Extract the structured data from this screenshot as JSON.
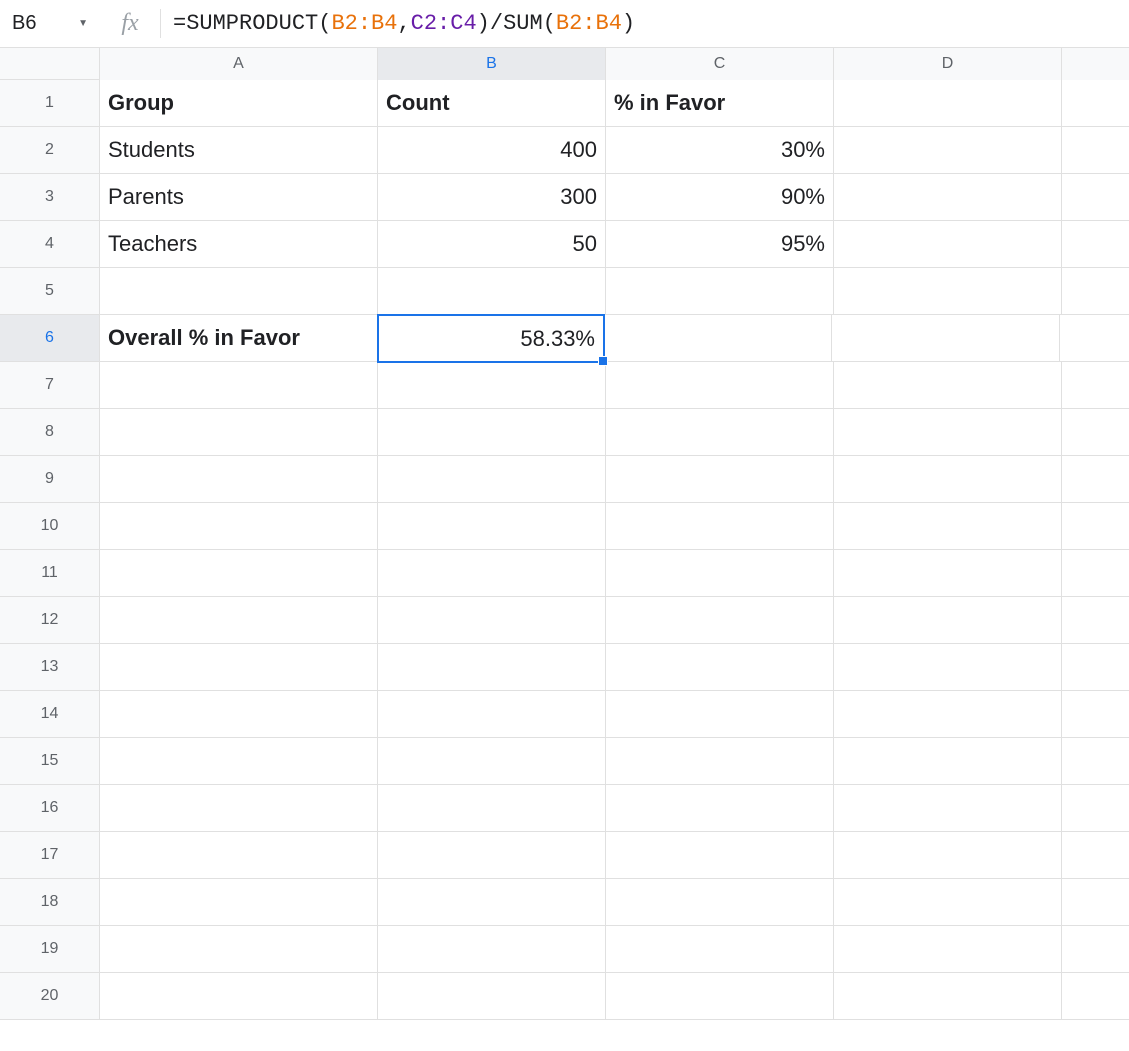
{
  "nameBox": "B6",
  "formula": {
    "prefix": "=SUMPRODUCT",
    "paren1": "(",
    "range1": "B2:B4",
    "comma": ", ",
    "range2": "C2:C4",
    "paren2": ")",
    "div": "/SUM",
    "paren3": "(",
    "range3": "B2:B4",
    "paren4": ")"
  },
  "columns": [
    "A",
    "B",
    "C",
    "D"
  ],
  "activeCol": "B",
  "activeRow": "6",
  "rows": [
    "1",
    "2",
    "3",
    "4",
    "5",
    "6",
    "7",
    "8",
    "9",
    "10",
    "11",
    "12",
    "13",
    "14",
    "15",
    "16",
    "17",
    "18",
    "19",
    "20"
  ],
  "cells": {
    "A1": "Group",
    "B1": "Count",
    "C1": "% in Favor",
    "A2": "Students",
    "B2": "400",
    "C2": "30%",
    "A3": "Parents",
    "B3": "300",
    "C3": "90%",
    "A4": "Teachers",
    "B4": "50",
    "C4": "95%",
    "A6": "Overall % in Favor",
    "B6": "58.33%"
  },
  "selectedCell": "B6"
}
